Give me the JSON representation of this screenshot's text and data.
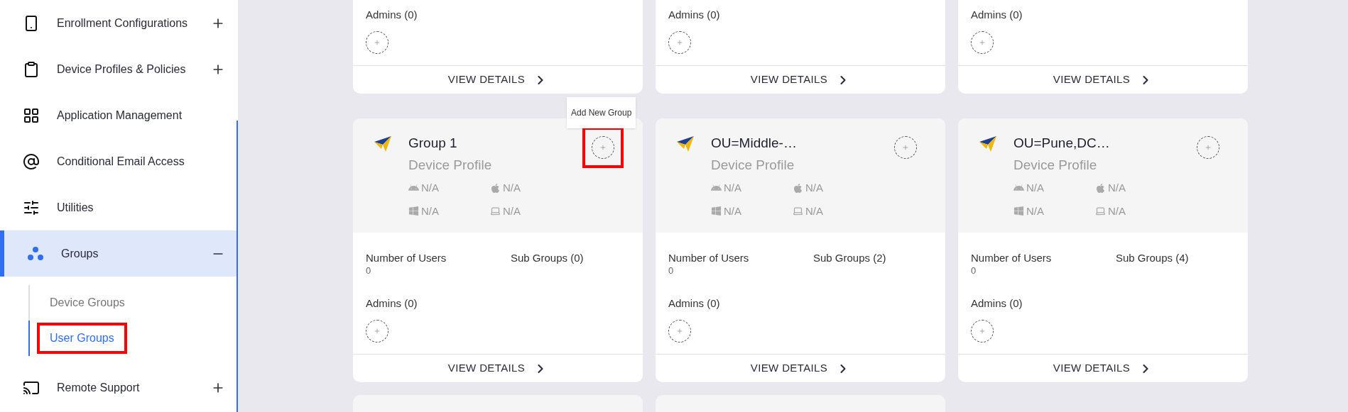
{
  "sidebar": {
    "items": [
      {
        "label": "Enrollment Configurations",
        "kind": "expandable",
        "expanded": false,
        "selected": false
      },
      {
        "label": "Device Profiles & Policies",
        "kind": "expandable",
        "expanded": false,
        "selected": false
      },
      {
        "label": "Application Management",
        "kind": "link",
        "selected": false
      },
      {
        "label": "Conditional Email Access",
        "kind": "link",
        "selected": false
      },
      {
        "label": "Utilities",
        "kind": "link",
        "selected": false
      },
      {
        "label": "Groups",
        "kind": "expandable",
        "expanded": true,
        "selected": true,
        "children": [
          {
            "label": "Device Groups",
            "selected": false,
            "highlighted": false
          },
          {
            "label": "User Groups",
            "selected": true,
            "highlighted": true
          }
        ]
      },
      {
        "label": "Remote Support",
        "kind": "expandable",
        "expanded": false,
        "selected": false
      }
    ]
  },
  "cards": [
    {
      "kind": "footer",
      "admins": "Admins (0)",
      "action": "VIEW DETAILS"
    },
    {
      "kind": "footer",
      "admins": "Admins (0)",
      "action": "VIEW DETAILS"
    },
    {
      "kind": "footer",
      "admins": "Admins (0)",
      "action": "VIEW DETAILS"
    },
    {
      "kind": "full",
      "title": "Group 1",
      "subtitle": "Device Profile",
      "platforms": [
        "N/A",
        "N/A",
        "N/A",
        "N/A"
      ],
      "users_label": "Number of Users",
      "users": "0",
      "subgroups": "Sub Groups (0)",
      "admins": "Admins (0)",
      "action": "VIEW DETAILS",
      "tooltip": "Add New Group",
      "highlighted": true
    },
    {
      "kind": "full",
      "title": "OU=Middle-…",
      "subtitle": "Device Profile",
      "platforms": [
        "N/A",
        "N/A",
        "N/A",
        "N/A"
      ],
      "users_label": "Number of Users",
      "users": "0",
      "subgroups": "Sub Groups (2)",
      "admins": "Admins (0)",
      "action": "VIEW DETAILS",
      "highlighted": false
    },
    {
      "kind": "full",
      "title": "OU=Pune,DC…",
      "subtitle": "Device Profile",
      "platforms": [
        "N/A",
        "N/A",
        "N/A",
        "N/A"
      ],
      "users_label": "Number of Users",
      "users": "0",
      "subgroups": "Sub Groups (4)",
      "admins": "Admins (0)",
      "action": "VIEW DETAILS",
      "highlighted": false
    },
    {
      "kind": "cut"
    },
    {
      "kind": "cut"
    }
  ]
}
